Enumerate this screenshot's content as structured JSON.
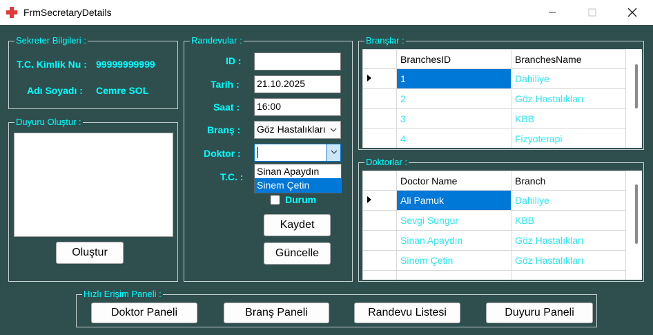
{
  "window": {
    "title": "FrmSecretaryDetails",
    "icon": "plus-cross-icon"
  },
  "sekreter": {
    "legend": "Sekreter Bilgileri :",
    "tc_label": "T.C. Kimlik Nu :",
    "tc_value": "99999999999",
    "name_label": "Adı Soyadı :",
    "name_value": "Cemre SOL"
  },
  "duyuru": {
    "legend": "Duyuru Oluştur :",
    "text": "",
    "button": "Oluştur"
  },
  "randevu": {
    "legend": "Randevular :",
    "id_label": "ID :",
    "id_value": "",
    "tarih_label": "Tarih :",
    "tarih_value": "21.10.2025",
    "saat_label": "Saat :",
    "saat_value": "16:00",
    "brans_label": "Branş :",
    "brans_value": "Göz Hastalıkları",
    "doktor_label": "Doktor :",
    "doktor_value": "",
    "doktor_options": [
      "Sinan Apaydın",
      "Sinem Çetin"
    ],
    "doktor_highlighted": "Sinem Çetin",
    "tc_label": "T.C. :",
    "durum_label": "Durum",
    "kaydet": "Kaydet",
    "guncelle": "Güncelle"
  },
  "branslar": {
    "legend": "Branşlar :",
    "columns": [
      "BranchesID",
      "BranchesName"
    ],
    "rows": [
      [
        "1",
        "Dahiliye"
      ],
      [
        "2",
        "Göz Hastalıkları"
      ],
      [
        "3",
        "KBB"
      ],
      [
        "4",
        "Fizyoterapi"
      ]
    ]
  },
  "doktorlar": {
    "legend": "Doktorlar :",
    "columns": [
      "Doctor Name",
      "Branch"
    ],
    "rows": [
      [
        "Ali Pamuk",
        "Dahiliye"
      ],
      [
        "Sevgi Sungur",
        "KBB"
      ],
      [
        "Sinan Apaydın",
        "Göz Hastalıkları"
      ],
      [
        "Sinem Çetin",
        "Göz Hastalıkları"
      ]
    ]
  },
  "hizli": {
    "legend": "Hızlı Erişim Paneli :",
    "buttons": [
      "Doktor Paneli",
      "Branş Paneli",
      "Randevu Listesi",
      "Duyuru Paneli"
    ]
  },
  "colors": {
    "background": "#2f4f4f",
    "label": "#00ffff",
    "selection": "#0078d7",
    "cell_text": "#2ee6ef"
  }
}
